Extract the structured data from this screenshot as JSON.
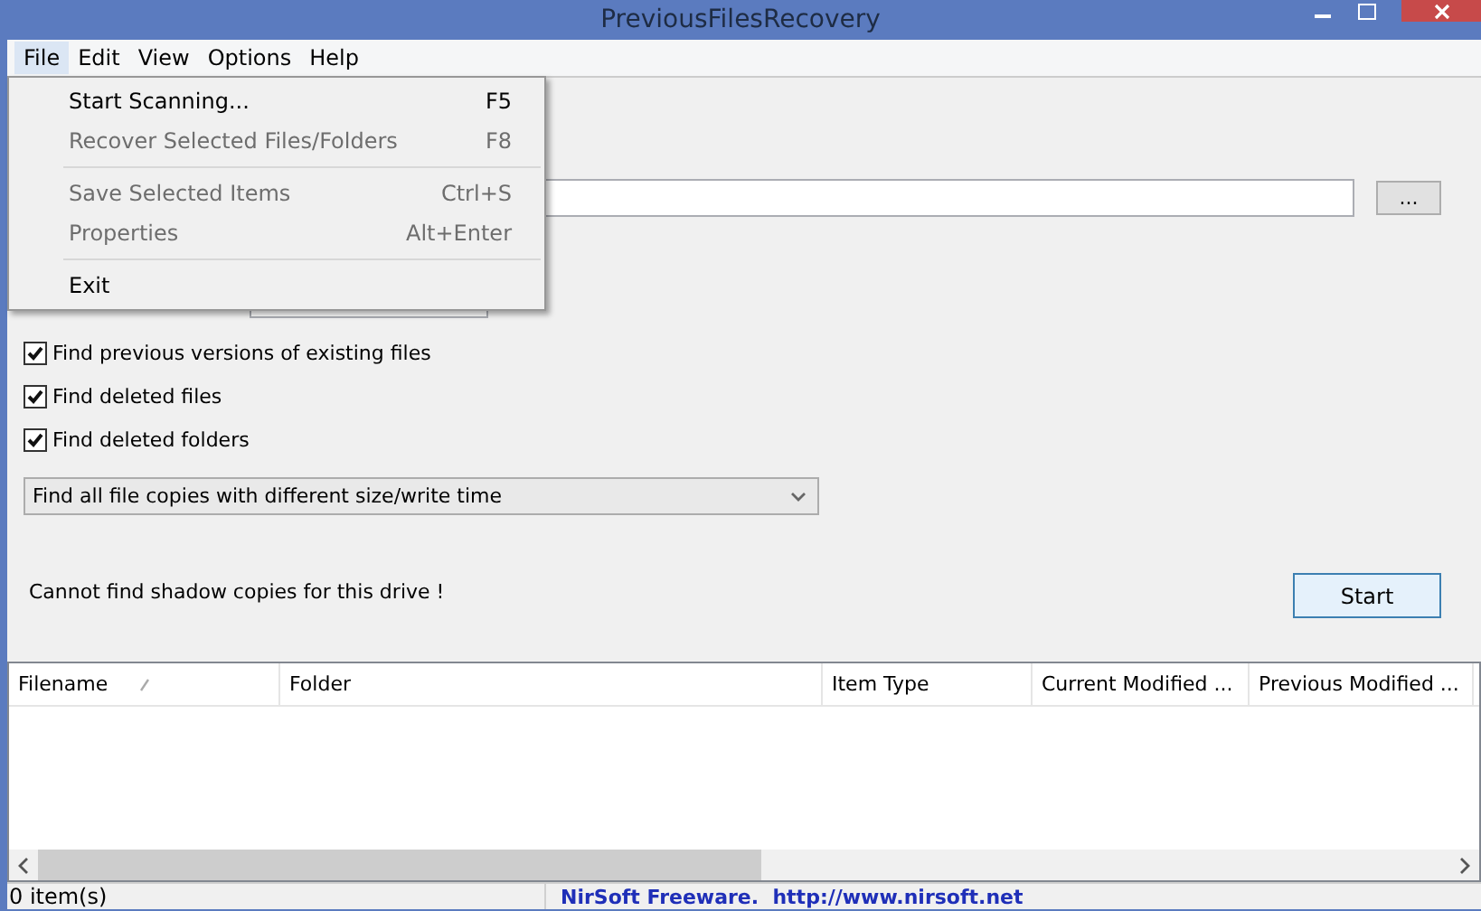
{
  "window": {
    "title": "PreviousFilesRecovery"
  },
  "menu_bar": [
    {
      "label": "File",
      "selected": true
    },
    {
      "label": "Edit",
      "selected": false
    },
    {
      "label": "View",
      "selected": false
    },
    {
      "label": "Options",
      "selected": false
    },
    {
      "label": "Help",
      "selected": false
    }
  ],
  "file_menu": [
    {
      "kind": "item",
      "label": "Start Scanning...",
      "shortcut": "F5",
      "disabled": false
    },
    {
      "kind": "item",
      "label": "Recover Selected Files/Folders",
      "shortcut": "F8",
      "disabled": true
    },
    {
      "kind": "separator"
    },
    {
      "kind": "item",
      "label": "Save Selected Items",
      "shortcut": "Ctrl+S",
      "disabled": true
    },
    {
      "kind": "item",
      "label": "Properties",
      "shortcut": "Alt+Enter",
      "disabled": true
    },
    {
      "kind": "separator"
    },
    {
      "kind": "item",
      "label": "Exit",
      "disabled": false
    }
  ],
  "browse_button": "...",
  "options": [
    {
      "label": "Find previous versions of existing files",
      "checked": true
    },
    {
      "label": "Find deleted files",
      "checked": true
    },
    {
      "label": "Find deleted folders",
      "checked": true
    }
  ],
  "mode_select": {
    "value": "Find all file copies with different size/write time"
  },
  "message": "Cannot find shadow copies for this drive !",
  "start_button": "Start",
  "table": {
    "columns": [
      {
        "label": "Filename",
        "sorted": true
      },
      {
        "label": "Folder",
        "sorted": false
      },
      {
        "label": "Item Type",
        "sorted": false
      },
      {
        "label": "Current Modified ...",
        "sorted": false
      },
      {
        "label": "Previous Modified ...",
        "sorted": false
      }
    ]
  },
  "status_bar": {
    "count": "0 item(s)",
    "credit": "NirSoft Freeware.  http://www.nirsoft.net"
  }
}
